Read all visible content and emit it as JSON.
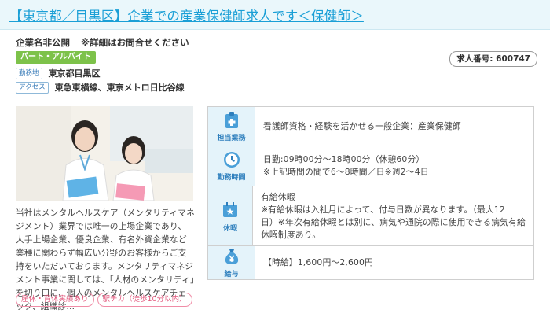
{
  "title": "【東京都／目黒区】企業での産業保健師求人です＜保健師＞",
  "company": {
    "name": "企業名非公開",
    "note": "※詳細はお問合せください"
  },
  "employment_type": "パート・アルバイト",
  "job_number": "求人番号: 600747",
  "location": {
    "label": "勤務地",
    "value": "東京都目黒区"
  },
  "access": {
    "label": "アクセス",
    "value": "東急東横線、東京メトロ日比谷線"
  },
  "description": "当社はメンタルヘルスケア（メンタリティマネジメント）業界では唯一の上場企業であり、大手上場企業、優良企業、有名外資企業など業種に関わらず幅広い分野のお客様からご支持をいただいております。メンタリティマネジメント事業に関しては、「人材のメンタリティ」を切り口に、個人のメンタルヘルスケアチェック、組織診…",
  "tags": [
    "産休・育休実績あり",
    "駅チカ（徒歩10分以内）"
  ],
  "details": [
    {
      "icon": "clipboard-icon",
      "label": "担当業務",
      "lines": [
        "看護師資格・経験を活かせる一般企業：産業保健師"
      ]
    },
    {
      "icon": "clock-icon",
      "label": "勤務時間",
      "lines": [
        "日勤:09時00分～18時00分（休憩60分）",
        "※上記時間の間で6～8時間／日※週2～4日"
      ]
    },
    {
      "icon": "calendar-icon",
      "label": "休暇",
      "lines": [
        "有給休暇",
        "※有給休暇は入社月によって、付与日数が異なります。（最大12",
        "日）※年次有給休暇とは別に、病気や通院の際に使用できる病気有給",
        "休暇制度あり。"
      ]
    },
    {
      "icon": "money-bag-icon",
      "label": "給与",
      "lines": [
        "【時給】1,600円～2,600円"
      ]
    }
  ],
  "colors": {
    "accent": "#1a9fd6",
    "green": "#7dc24a",
    "pink": "#e2577c",
    "header_bg": "#e4f3fa"
  }
}
